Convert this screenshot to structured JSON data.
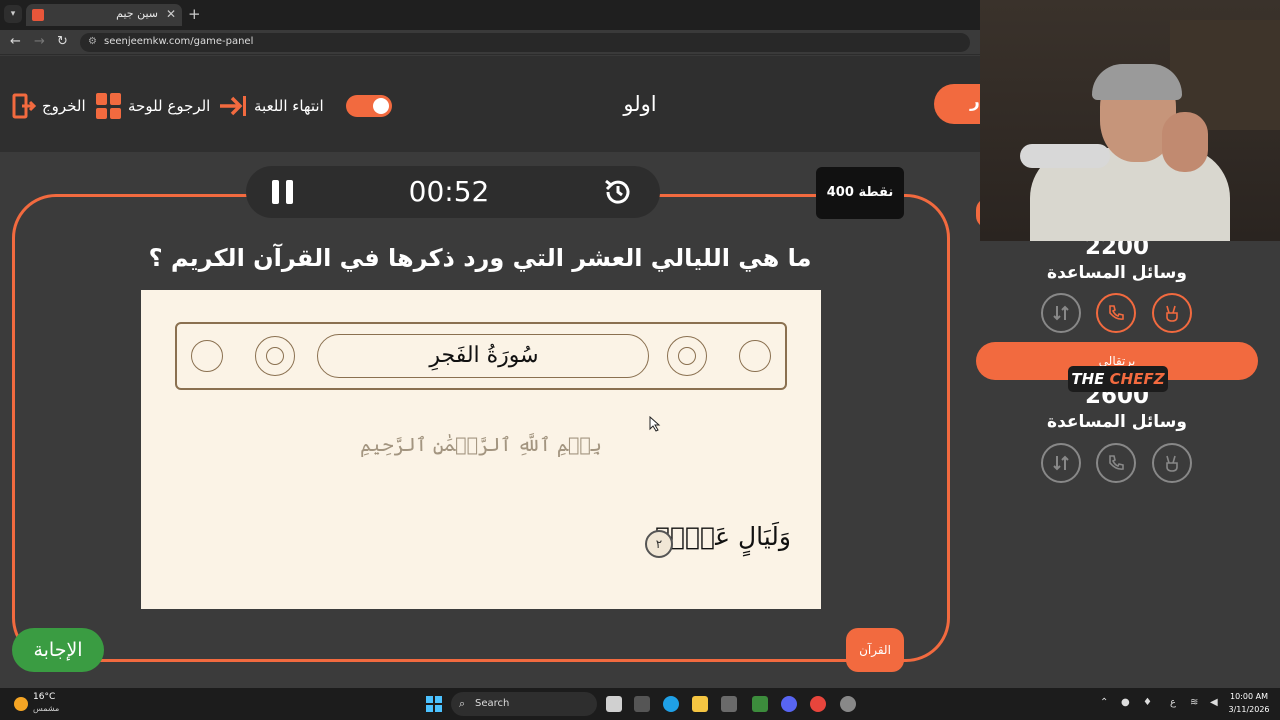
{
  "browser": {
    "tab_title": "سين جيم",
    "tab_close": "✕",
    "new_tab": "+",
    "url": "seenjeemkw.com/game-panel"
  },
  "header": {
    "exit_label": "الخروج",
    "back_label": "الرجوع للوحة",
    "end_game_label": "انتهاء اللعبة",
    "team_name": "اولو",
    "start_pill_text": "ر"
  },
  "question": {
    "points": "400 نقطة",
    "timer": "00:52",
    "text": "ما هي الليالي العشر التي ورد ذكرها في القرآن الكريم ؟",
    "image": {
      "surah_title": "سُورَةُ الفَجرِ",
      "bismillah": "بِسۡمِ ٱللَّهِ ٱلرَّحۡمَٰنِ ٱلرَّحِيمِ",
      "verse": "وَلَيَالٍ عَشۡرٖ",
      "ayah_number": "٢"
    },
    "answer_button": "الإجابة",
    "category": "القرآن"
  },
  "teams": [
    {
      "score": "2200",
      "aids_label": "وسائل المساعدة"
    },
    {
      "name": "برتقالي",
      "score": "2600",
      "aids_label": "وسائل المساعدة"
    }
  ],
  "sponsor": {
    "part1": "THE ",
    "part2": "CHEFZ"
  },
  "taskbar": {
    "temp": "16°C",
    "weather": "مشمس",
    "search": "Search",
    "lang": "ع",
    "time": "10:00 AM",
    "date": "3/11/2026"
  },
  "colors": {
    "accent": "#f26a3f",
    "answer_green": "#3a9c42",
    "background": "#3b3b3b",
    "header_bg": "#2f2f2f"
  }
}
